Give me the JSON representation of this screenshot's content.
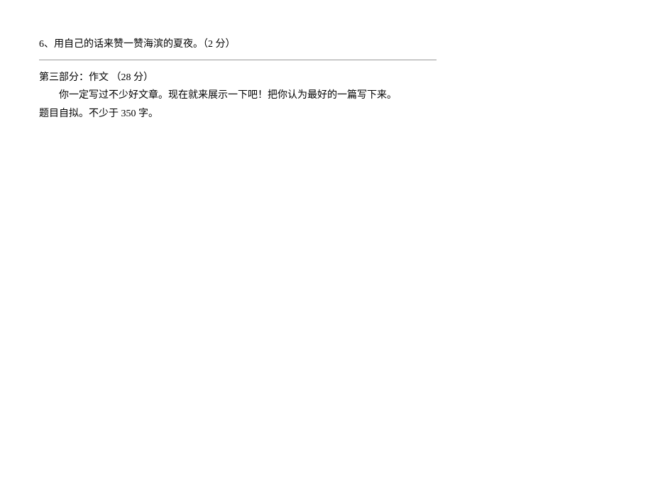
{
  "q6": {
    "text": "6、用自己的话来赞一赞海滨的夏夜。（2 分）"
  },
  "part3": {
    "heading": "第三部分：作文 （28 分）",
    "body1": "你一定写过不少好文章。现在就来展示一下吧！把你认为最好的一篇写下来。",
    "body2": "题目自拟。不少于 350 字。"
  }
}
